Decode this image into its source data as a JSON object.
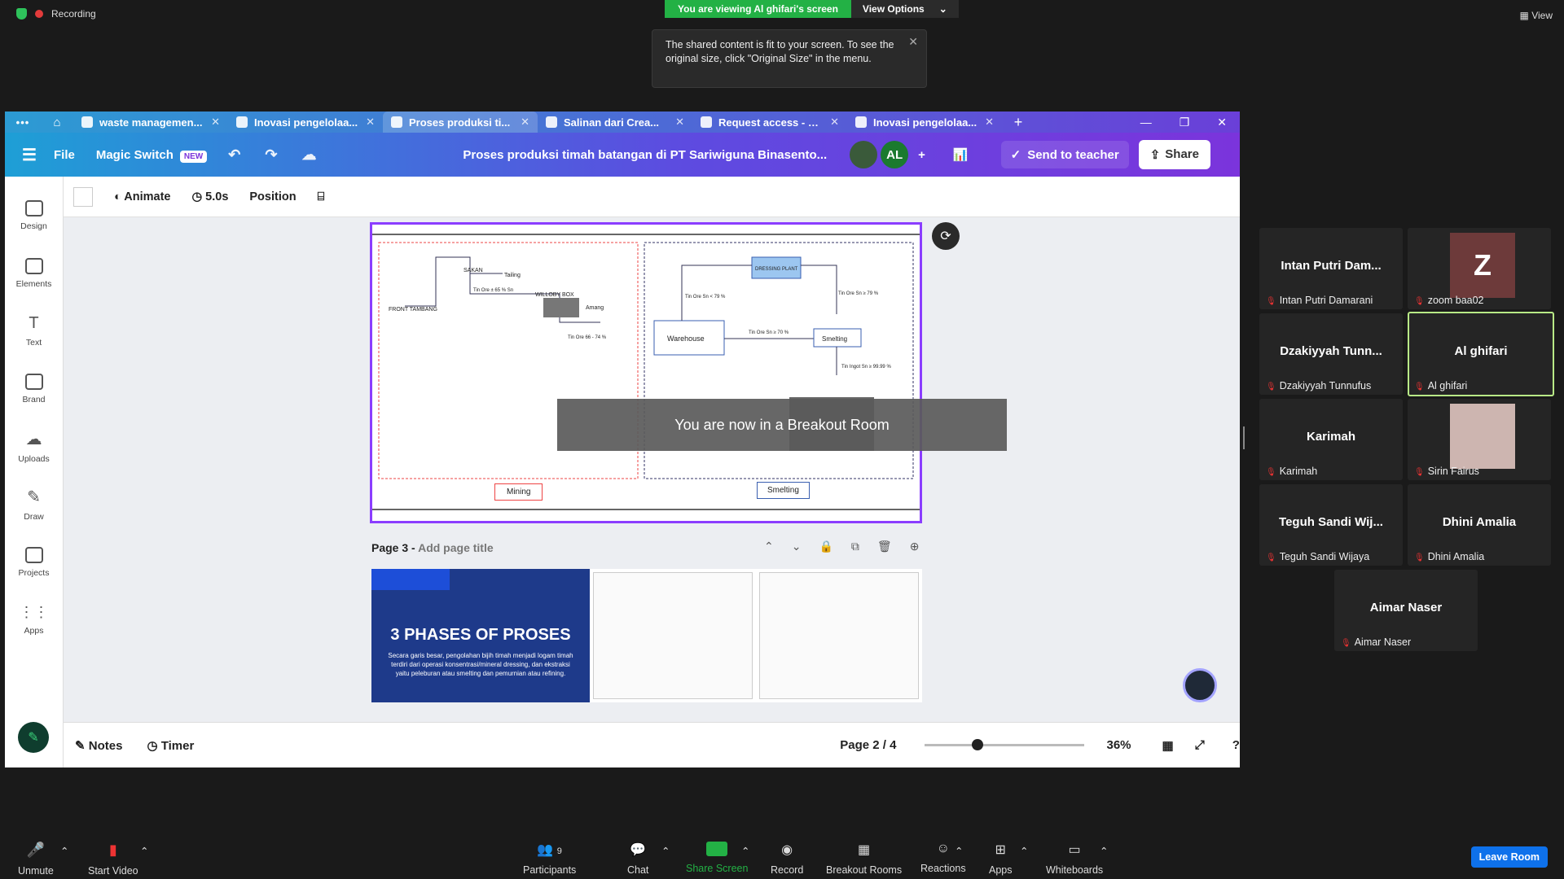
{
  "zoom_top": {
    "recording": "Recording",
    "viewing_banner": "You are viewing Al ghifari's screen",
    "view_options": "View Options",
    "tip_text": "The shared content is fit to your screen. To see the original size, click \"Original Size\" in the menu.",
    "view_label": "View"
  },
  "tabs": [
    {
      "label": "waste managemen..."
    },
    {
      "label": "Inovasi pengelolaa..."
    },
    {
      "label": "Proses produksi ti..."
    },
    {
      "label": "Salinan dari Crea..."
    },
    {
      "label": "Request access - C..."
    },
    {
      "label": "Inovasi pengelolaa..."
    }
  ],
  "menubar": {
    "file": "File",
    "magic_switch": "Magic Switch",
    "new_badge": "NEW",
    "doc_title": "Proses produksi timah batangan di PT Sariwiguna Binasento...",
    "avatar_initials": "AL",
    "send_to_teacher": "Send to teacher",
    "share": "Share"
  },
  "sidebar": [
    {
      "label": "Design"
    },
    {
      "label": "Elements"
    },
    {
      "label": "Text"
    },
    {
      "label": "Brand"
    },
    {
      "label": "Uploads"
    },
    {
      "label": "Draw"
    },
    {
      "label": "Projects"
    },
    {
      "label": "Apps"
    }
  ],
  "toolrow": {
    "animate": "Animate",
    "duration": "5.0s",
    "position": "Position"
  },
  "slide": {
    "nodes": {
      "sakan": "SAKAN",
      "tailing": "Tailing",
      "tin_ore_65": "Tin Ore ± 65 % Sn",
      "willoby_box": "WILLOBY BOX",
      "amang": "Amang",
      "front_tambang": "FRONT TAMBANG",
      "tin_ore_66": "Tin Ore 66 - 74 %",
      "warehouse": "Warehouse",
      "dressing_plant": "DRESSING PLANT",
      "tin_ore_lt79": "Tin Ore Sn < 79 %",
      "tin_ore_ge79": "Tin Ore Sn ≥ 79 %",
      "tin_ore_70": "Tin Ore Sn ≥ 70 %",
      "smelting_node": "Smelting",
      "tin_ingot": "Tin Ingot Sn ≥ 99.99 %"
    },
    "section_mining": "Mining",
    "section_smelting": "Smelting"
  },
  "breakout_msg": "You are now in a Breakout Room",
  "page3": {
    "label": "Page 3 -",
    "placeholder": "Add page title",
    "thumb_title": "3 PHASES OF PROSES",
    "thumb_text": "Secara garis besar, pengolahan bijih timah menjadi logam timah terdiri dari operasi konsentrasi/mineral dressing, dan ekstraksi yaitu peleburan atau smelting dan pemurnian atau refining."
  },
  "bottombar": {
    "notes": "Notes",
    "timer": "Timer",
    "page": "Page 2 / 4",
    "zoom": "36%",
    "zoom_level": 0.36
  },
  "participants": [
    {
      "name": "Intan Putri Dam...",
      "label": "Intan Putri Damarani"
    },
    {
      "name": "Z",
      "label": "zoom baa02"
    },
    {
      "name": "Dzakiyyah Tunn...",
      "label": "Dzakiyyah Tunnufus"
    },
    {
      "name": "Al ghifari",
      "label": "Al ghifari"
    },
    {
      "name": "Karimah",
      "label": "Karimah"
    },
    {
      "name": "",
      "label": "Sirin Fairus"
    },
    {
      "name": "Teguh Sandi Wij...",
      "label": "Teguh Sandi Wijaya"
    },
    {
      "name": "Dhini Amalia",
      "label": "Dhini Amalia"
    },
    {
      "name": "Aimar Naser",
      "label": "Aimar Naser"
    }
  ],
  "zoom_bottom": {
    "unmute": "Unmute",
    "start_video": "Start Video",
    "participants": "Participants",
    "participants_count": "9",
    "chat": "Chat",
    "share_screen": "Share Screen",
    "record": "Record",
    "breakout_rooms": "Breakout Rooms",
    "reactions": "Reactions",
    "apps": "Apps",
    "whiteboards": "Whiteboards",
    "leave_room": "Leave Room"
  }
}
